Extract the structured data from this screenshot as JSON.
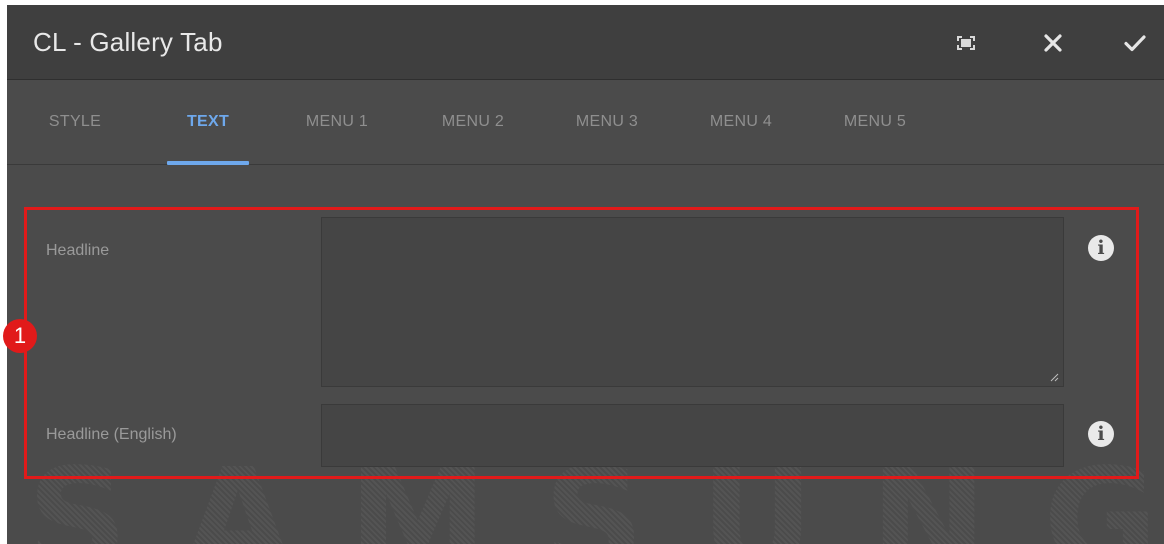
{
  "dialog": {
    "title": "CL - Gallery Tab",
    "actions": [
      {
        "name": "fullscreen",
        "icon": "fullscreen-icon"
      },
      {
        "name": "close",
        "icon": "close-icon"
      },
      {
        "name": "confirm",
        "icon": "checkmark-icon"
      }
    ]
  },
  "tabs": [
    {
      "label": "STYLE",
      "active": false
    },
    {
      "label": "TEXT",
      "active": true
    },
    {
      "label": "MENU 1",
      "active": false
    },
    {
      "label": "MENU 2",
      "active": false
    },
    {
      "label": "MENU 3",
      "active": false
    },
    {
      "label": "MENU 4",
      "active": false
    },
    {
      "label": "MENU 5",
      "active": false
    }
  ],
  "fields": {
    "headline": {
      "label": "Headline",
      "value": "",
      "type": "textarea",
      "info_icon": "info-icon"
    },
    "headline_english": {
      "label": "Headline (English)",
      "value": "",
      "type": "text",
      "info_icon": "info-icon"
    }
  },
  "annotation": {
    "step_number": "1",
    "color": "#e11a1a"
  },
  "watermark": "SAMSUNG",
  "colors": {
    "accent": "#6ea8ec",
    "panel": "#4b4b4b",
    "titlebar": "#3f3f3f",
    "highlight": "#e11a1a"
  }
}
